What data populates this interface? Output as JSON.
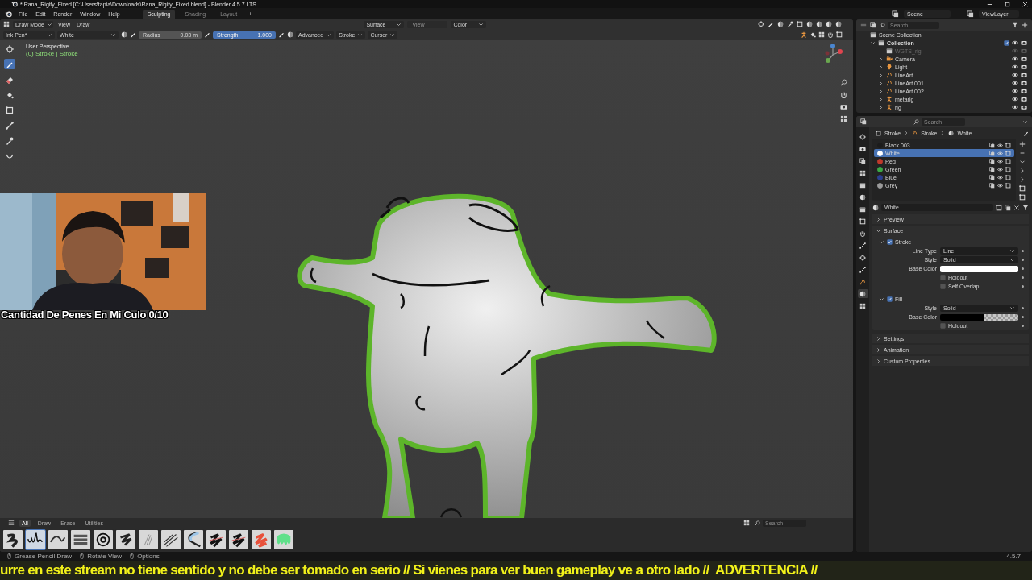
{
  "window": {
    "title": "* Rana_Rigify_Fixed [C:\\Users\\tapia\\Downloads\\Rana_Rigify_Fixed.blend] - Blender 4.5.7 LTS"
  },
  "menu": [
    "File",
    "Edit",
    "Render",
    "Window",
    "Help"
  ],
  "workspace_tabs": [
    {
      "label": "Sculpting",
      "selected": true
    },
    {
      "label": "Shading",
      "selected": false
    },
    {
      "label": "Layout",
      "selected": false
    }
  ],
  "add_tab": "+",
  "scene": "Scene",
  "view_layer": "ViewLayer",
  "viewport_header": {
    "mode": "Draw Mode",
    "menus": [
      "View",
      "Draw"
    ],
    "surface": "Surface",
    "view": {
      "label": "View",
      "disabled": true
    },
    "color_mode": "Color"
  },
  "tool_settings": {
    "brush": "Ink Pen*",
    "material": "White",
    "radius": {
      "label": "Radius",
      "value": "0.03 m"
    },
    "strength": {
      "label": "Strength",
      "value": "1.000",
      "level": 1
    },
    "menus": [
      "Advanced",
      "Stroke",
      "Cursor"
    ]
  },
  "toolbar": [
    {
      "kind": "cursor",
      "selected": false
    },
    {
      "kind": "pen",
      "selected": true
    },
    {
      "kind": "eraser",
      "selected": false
    },
    {
      "kind": "fill",
      "selected": false
    },
    {
      "kind": "box",
      "selected": false
    },
    {
      "kind": "line",
      "selected": false
    },
    {
      "kind": "eyedropper",
      "selected": false
    },
    {
      "kind": "curve",
      "selected": false
    }
  ],
  "viewport": {
    "perspective": "User Perspective",
    "context": "(0) Stroke | Stroke"
  },
  "overlay_caption": "Cantidad De Penes En Mi Culo 0/10",
  "asset_shelf": {
    "tabs": [
      {
        "label": "All",
        "selected": true
      },
      {
        "label": "Draw",
        "selected": false
      },
      {
        "label": "Erase",
        "selected": false
      },
      {
        "label": "Utilities",
        "selected": false
      }
    ],
    "brushes": [
      {
        "selected": false
      },
      {
        "selected": true
      },
      {
        "selected": false
      },
      {
        "selected": false
      },
      {
        "selected": false
      },
      {
        "selected": false
      },
      {
        "selected": false
      },
      {
        "selected": false
      },
      {
        "selected": false
      },
      {
        "selected": false
      },
      {
        "selected": false
      },
      {
        "selected": false
      },
      {
        "selected": false
      }
    ],
    "search": {
      "placeholder": "Search"
    }
  },
  "outliner": {
    "search": {
      "placeholder": "Search"
    },
    "tree": [
      {
        "label": "Scene Collection",
        "kind": "collection",
        "children": [
          {
            "label": "Collection",
            "kind": "collection",
            "expanded": true,
            "checked": true,
            "children": [
              {
                "label": "WGTS_rig",
                "kind": "collection",
                "disabled": true
              },
              {
                "label": "Camera",
                "kind": "camera",
                "expanded": false
              },
              {
                "label": "Light",
                "kind": "light",
                "expanded": false
              },
              {
                "label": "LineArt",
                "kind": "stroke",
                "expanded": false
              },
              {
                "label": "LineArt.001",
                "kind": "stroke",
                "expanded": false
              },
              {
                "label": "LineArt.002",
                "kind": "stroke",
                "expanded": false
              },
              {
                "label": "metarig",
                "kind": "armature",
                "expanded": false
              },
              {
                "label": "rig",
                "kind": "armature",
                "expanded": false
              }
            ]
          }
        ]
      }
    ]
  },
  "properties": {
    "search": {
      "placeholder": "Search"
    },
    "tabs": [
      {
        "selected": false
      },
      {
        "selected": false
      },
      {
        "selected": false
      },
      {
        "selected": false
      },
      {
        "selected": false
      },
      {
        "selected": false
      },
      {
        "selected": false
      },
      {
        "selected": false
      },
      {
        "selected": false
      },
      {
        "selected": false
      },
      {
        "selected": false
      },
      {
        "selected": false
      },
      {
        "selected": false
      },
      {
        "selected": true
      },
      {
        "selected": false
      }
    ],
    "breadcrumb": [
      "Stroke",
      "Stroke",
      "White"
    ],
    "material_slots": [
      {
        "name": "Black.003",
        "color": "#1c1c1c",
        "selected": false
      },
      {
        "name": "White",
        "color": "#ffffff",
        "selected": true
      },
      {
        "name": "Red",
        "color": "#c0392b",
        "selected": false
      },
      {
        "name": "Green",
        "color": "#3aa845",
        "selected": false
      },
      {
        "name": "Blue",
        "color": "#2b3f8f",
        "selected": false
      },
      {
        "name": "Grey",
        "color": "#9a9a9a",
        "selected": false
      }
    ],
    "material_name": "White",
    "panels": [
      {
        "label": "Preview",
        "expanded": false
      },
      {
        "label": "Surface",
        "expanded": true,
        "subpanels": [
          {
            "label": "Stroke",
            "checked": true,
            "rows": [
              {
                "kind": "dropdown",
                "label": "Line Type",
                "value": "Line"
              },
              {
                "kind": "dropdown",
                "label": "Style",
                "value": "Solid"
              },
              {
                "kind": "color",
                "label": "Base Color",
                "color": "#ffffff",
                "transparent": false
              },
              {
                "kind": "checkbox",
                "label": "Holdout",
                "checked": false
              },
              {
                "kind": "checkbox",
                "label": "Self Overlap",
                "checked": false
              }
            ]
          },
          {
            "label": "Fill",
            "checked": true,
            "rows": [
              {
                "kind": "dropdown",
                "label": "Style",
                "value": "Solid"
              },
              {
                "kind": "color",
                "label": "Base Color",
                "color": "#000000",
                "transparent": true
              },
              {
                "kind": "checkbox",
                "label": "Holdout",
                "checked": false
              }
            ]
          }
        ]
      },
      {
        "label": "Settings",
        "expanded": false
      },
      {
        "label": "Animation",
        "expanded": false
      },
      {
        "label": "Custom Properties",
        "expanded": false
      }
    ]
  },
  "status_bar": {
    "hints": [
      "Grease Pencil Draw",
      "Rotate View",
      "Options"
    ],
    "version": "4.5.7"
  },
  "ticker": "urre en este stream no tiene sentido y no debe ser tomado en serio // Si vienes para ver buen gameplay ve a otro lado //  ADVERTENCIA //"
}
